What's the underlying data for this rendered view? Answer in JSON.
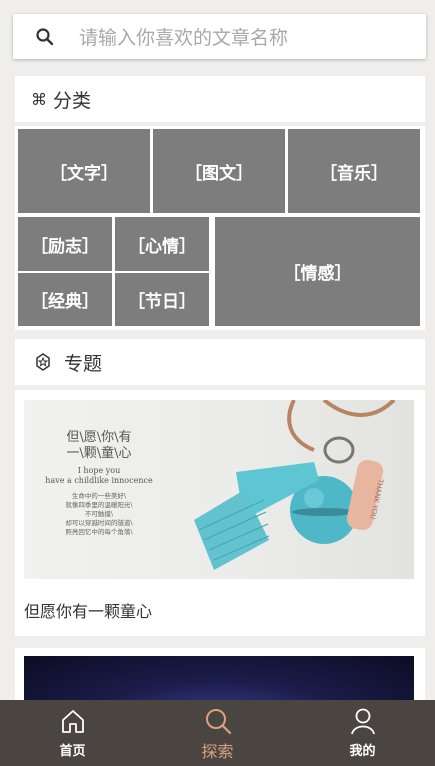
{
  "search": {
    "placeholder": "请输入你喜欢的文章名称"
  },
  "categories_section": {
    "icon": "command-icon",
    "icon_glyph": "⌘",
    "title": "分类"
  },
  "categories": [
    {
      "label": "［文字］"
    },
    {
      "label": "［图文］"
    },
    {
      "label": "［音乐］"
    },
    {
      "label": "［励志］"
    },
    {
      "label": "［心情］"
    },
    {
      "label": "［情感］"
    },
    {
      "label": "［经典］"
    },
    {
      "label": "［节日］"
    }
  ],
  "topics_section": {
    "icon": "badge-icon",
    "title": "专题"
  },
  "feature": {
    "image_text": {
      "line1": "但\\愿\\你\\有",
      "line2": "一\\颗\\童\\心",
      "line3": "I hope you",
      "line4": "have a childlike innocence",
      "line5": "生命中的一些美好\\",
      "line6": "就像四季里的温暖阳光\\",
      "line7": "不可触摸\\",
      "line8": "却可以穿越时间的隧道\\",
      "line9": "照亮回忆中的每个角落\\",
      "tag": "THANK YOU"
    },
    "title": "但愿你有一颗童心"
  },
  "tabbar": {
    "tabs": [
      {
        "label": "首页",
        "icon": "home-icon"
      },
      {
        "label": "探索",
        "icon": "search-icon"
      },
      {
        "label": "我的",
        "icon": "user-icon"
      }
    ],
    "active_color": "#d8a27e"
  }
}
